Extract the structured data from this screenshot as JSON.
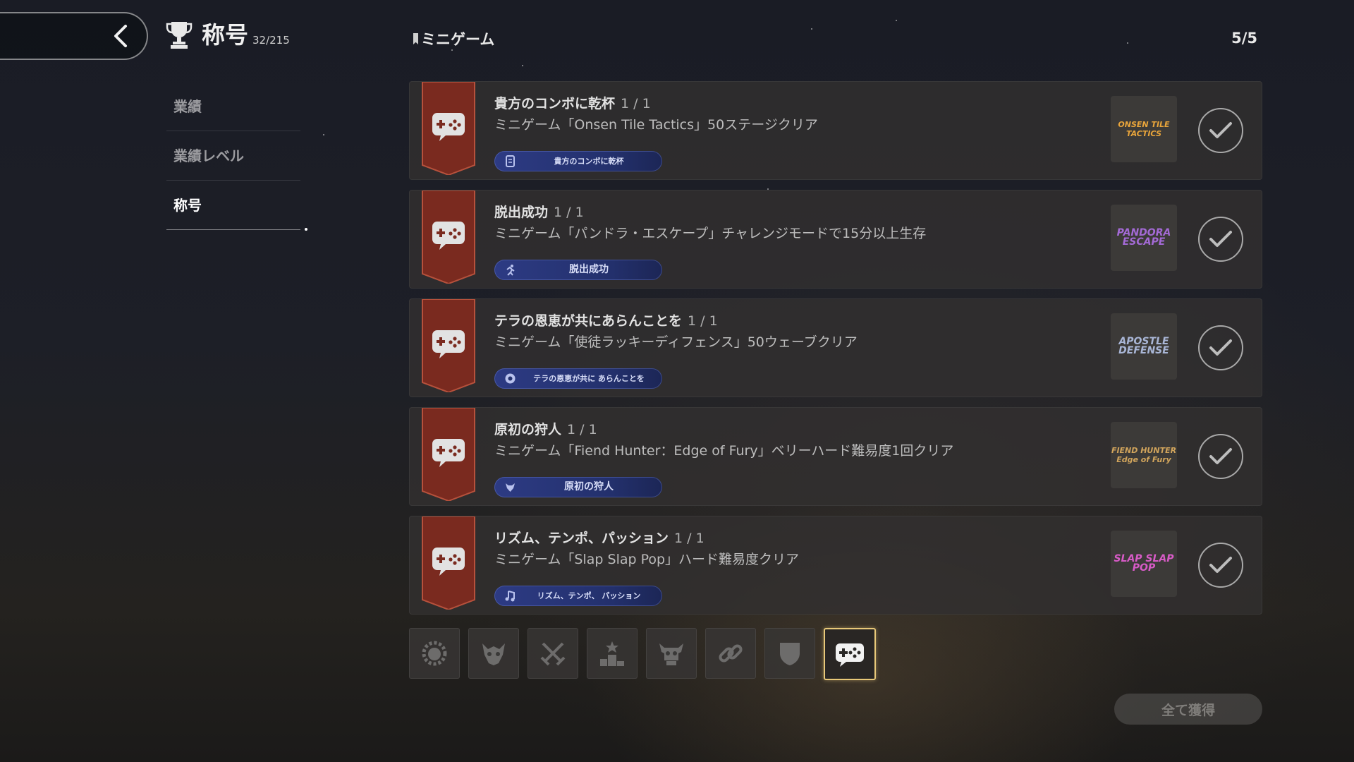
{
  "header": {
    "title": "称号",
    "count": "32/215",
    "section": "ミニゲーム",
    "page_indicator": "5/5"
  },
  "sidebar": {
    "items": [
      {
        "label": "業績"
      },
      {
        "label": "業績レベル"
      },
      {
        "label": "称号"
      }
    ],
    "active_index": 2
  },
  "achievements": [
    {
      "title": "貴方のコンボに乾杯",
      "progress": "1 / 1",
      "description": "ミニゲーム「Onsen Tile Tactics」50ステージクリア",
      "reward": "貴方のコンボに乾杯",
      "reward_icon": "scroll-icon",
      "logo": "ONSEN TILE TACTICS",
      "logo_color": "#e9a53b",
      "completed": true
    },
    {
      "title": "脱出成功",
      "progress": "1 / 1",
      "description": "ミニゲーム「パンドラ・エスケープ」チャレンジモードで15分以上生存",
      "reward": "脱出成功",
      "reward_icon": "running-person-icon",
      "logo": "PANDORA ESCAPE",
      "logo_color": "#a46ad6",
      "completed": true
    },
    {
      "title": "テラの恩恵が共にあらんことを",
      "progress": "1 / 1",
      "description": "ミニゲーム「使徒ラッキーディフェンス」50ウェーブクリア",
      "reward": "テラの恩恵が共に あらんことを",
      "reward_icon": "emblem-icon",
      "logo": "APOSTLE DEFENSE",
      "logo_color": "#a9b6d6",
      "completed": true
    },
    {
      "title": "原初の狩人",
      "progress": "1 / 1",
      "description": "ミニゲーム「Fiend Hunter：Edge of Fury」ベリーハード難易度1回クリア",
      "reward": "原初の狩人",
      "reward_icon": "beast-icon",
      "logo": "FIEND HUNTER Edge of Fury",
      "logo_color": "#d2a55c",
      "completed": true
    },
    {
      "title": "リズム、テンポ、パッション",
      "progress": "1 / 1",
      "description": "ミニゲーム「Slap Slap Pop」ハード難易度クリア",
      "reward": "リズム、テンポ、 パッション",
      "reward_icon": "music-note-icon",
      "logo": "SLAP SLAP POP",
      "logo_color": "#d85bc7",
      "completed": true
    }
  ],
  "category_tabs": [
    {
      "icon": "lion-crest-icon"
    },
    {
      "icon": "demon-mask-icon"
    },
    {
      "icon": "crossed-swords-icon"
    },
    {
      "icon": "podium-icon"
    },
    {
      "icon": "skull-icon"
    },
    {
      "icon": "chain-link-icon"
    },
    {
      "icon": "shield-icon"
    },
    {
      "icon": "gamepad-icon"
    }
  ],
  "active_tab_index": 7,
  "claim_all_label": "全て獲得",
  "colors": {
    "banner": "#7a2a1f",
    "pill": "#2d3b84",
    "active_tab_border": "#e8c879"
  }
}
